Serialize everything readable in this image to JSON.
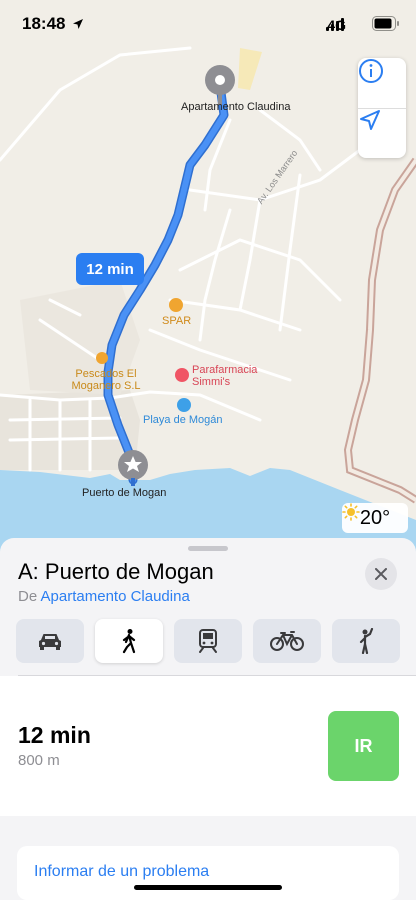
{
  "status_bar": {
    "time": "18:48",
    "network": "4G"
  },
  "map": {
    "origin_label": "Apartamento Claudina",
    "destination_label": "Puerto de Mogan",
    "eta_badge": "12 min",
    "pois": {
      "spar": "SPAR",
      "parafarmacia": "Parafarmacia Simmi's",
      "pescados": "Pescados El Moganero S.L",
      "playa": "Playa de Mogán"
    },
    "street": "Av. Los Marrero",
    "weather_temp": "20°"
  },
  "sheet": {
    "destination_title": "A: Puerto de Mogan",
    "from_prefix": "De",
    "from_origin": "Apartamento Claudina",
    "transport_modes": [
      {
        "name": "car",
        "icon": "car-icon"
      },
      {
        "name": "walk",
        "icon": "walk-icon",
        "selected": true
      },
      {
        "name": "transit",
        "icon": "train-icon"
      },
      {
        "name": "bike",
        "icon": "bike-icon"
      },
      {
        "name": "ride",
        "icon": "rideshare-icon"
      }
    ],
    "route": {
      "duration": "12 min",
      "distance": "800 m",
      "go_label": "IR"
    },
    "report_label": "Informar de un problema"
  },
  "colors": {
    "accent": "#2b7ef1",
    "go": "#6bd46b",
    "route": "#3a86f0"
  }
}
